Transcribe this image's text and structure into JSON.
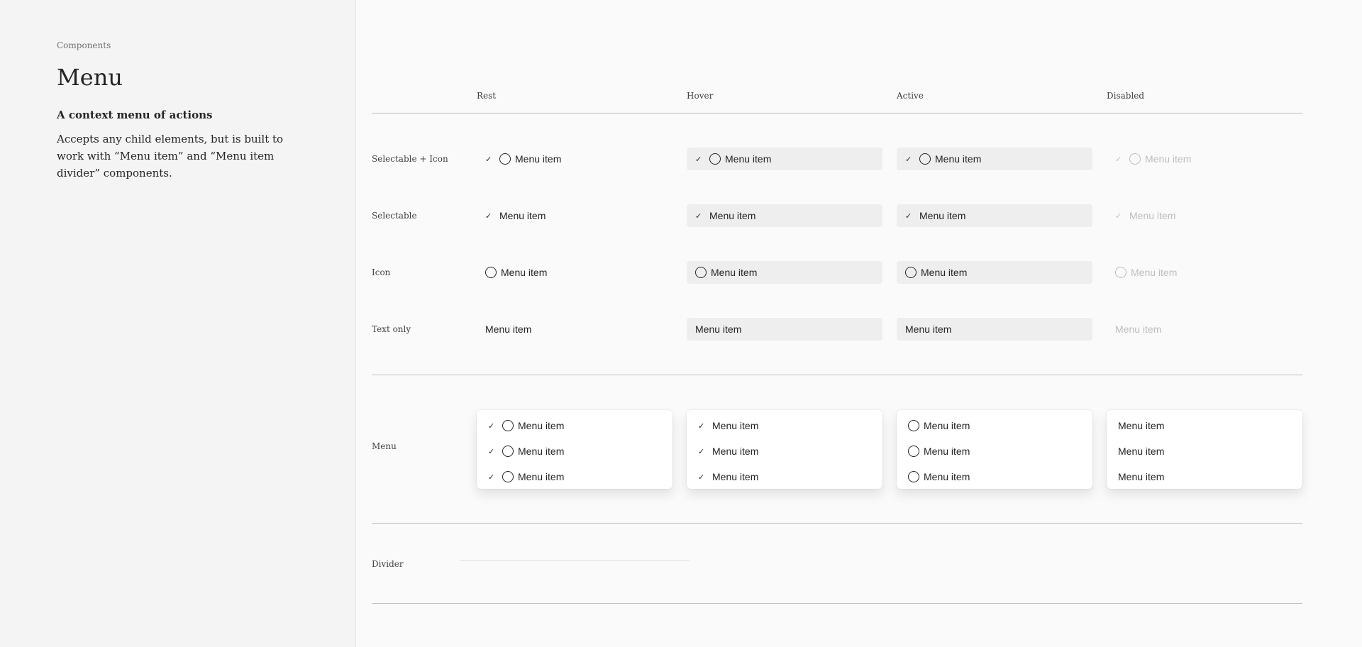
{
  "sidebar": {
    "breadcrumb": "Components",
    "title": "Menu",
    "subtitle": "A context menu of actions",
    "description": "Accepts any child elements, but is built to work with “Menu item” and “Menu item divider” components."
  },
  "columns": [
    "Rest",
    "Hover",
    "Active",
    "Disabled"
  ],
  "rows": [
    "Selectable + Icon",
    "Selectable",
    "Icon",
    "Text only",
    "Menu",
    "Divider"
  ],
  "item_label": "Menu item",
  "check_glyph": "✓",
  "colors": {
    "hover_bg": "#eeeeee",
    "disabled_text": "#bdbdbd",
    "text": "#242424"
  }
}
